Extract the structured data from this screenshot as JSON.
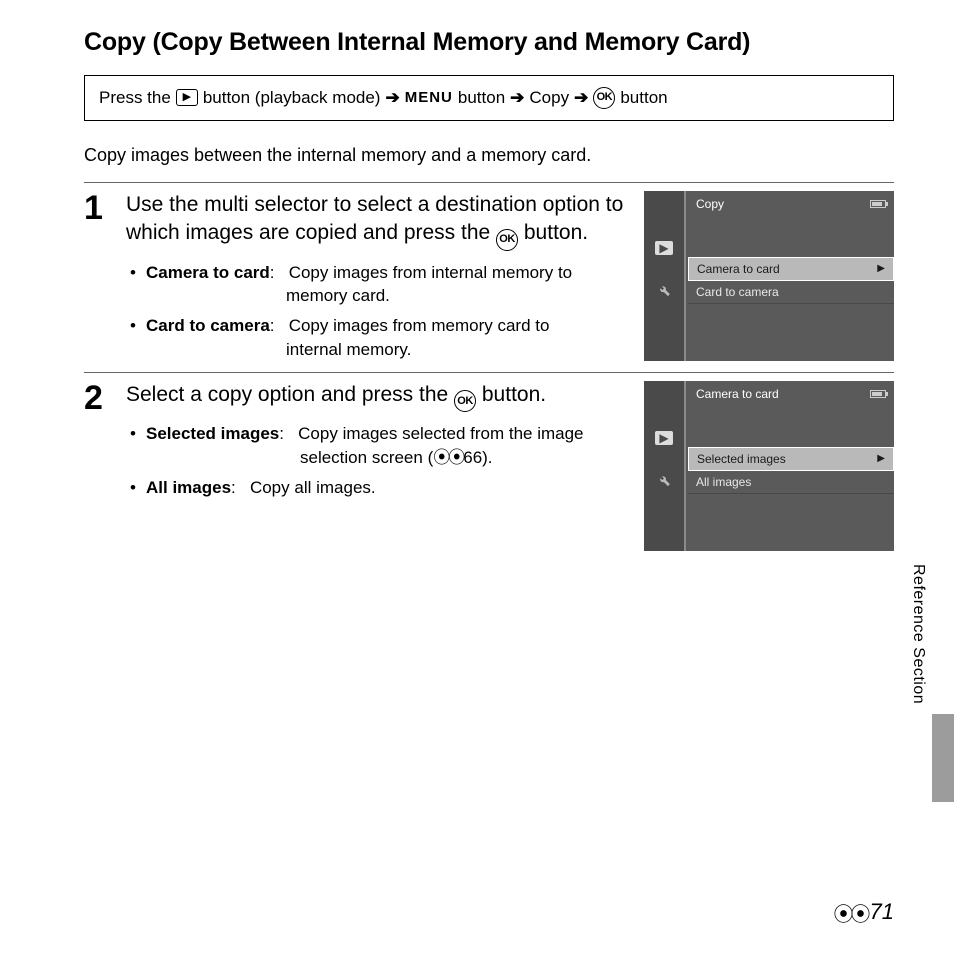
{
  "title": "Copy (Copy Between Internal Memory and Memory Card)",
  "breadcrumb": {
    "press_the": "Press the",
    "playback_mode": "button (playback mode)",
    "menu_word": "MENU",
    "button_word": "button",
    "copy_word": "Copy",
    "ok_button_word": "button"
  },
  "intro": "Copy images between the internal memory and a memory card.",
  "step1": {
    "num": "1",
    "heading_a": "Use the multi selector to select a destination option to which images are copied and press the ",
    "heading_b": " button.",
    "bullet1_term": "Camera to card",
    "bullet1_colon": ":",
    "bullet1_def_a": "Copy images from internal memory to",
    "bullet1_def_b": "memory card.",
    "bullet2_term": "Card to camera",
    "bullet2_colon": ":",
    "bullet2_def_a": "Copy images from memory card to",
    "bullet2_def_b": "internal memory.",
    "screen": {
      "title": "Copy",
      "row_selected": "Camera to card",
      "row_other": "Card to camera"
    }
  },
  "step2": {
    "num": "2",
    "heading_a": "Select a copy option and press the ",
    "heading_b": " button.",
    "bullet1_term": "Selected images",
    "bullet1_colon": ":",
    "bullet1_def_a": "Copy images selected from the image",
    "bullet1_def_b": "selection screen (",
    "bullet1_ref": "66).",
    "bullet2_term": "All images",
    "bullet2_colon": ":",
    "bullet2_def": "Copy all images.",
    "screen": {
      "title": "Camera to card",
      "row_selected": "Selected images",
      "row_other": "All images"
    }
  },
  "side_label": "Reference Section",
  "page_num": "71"
}
